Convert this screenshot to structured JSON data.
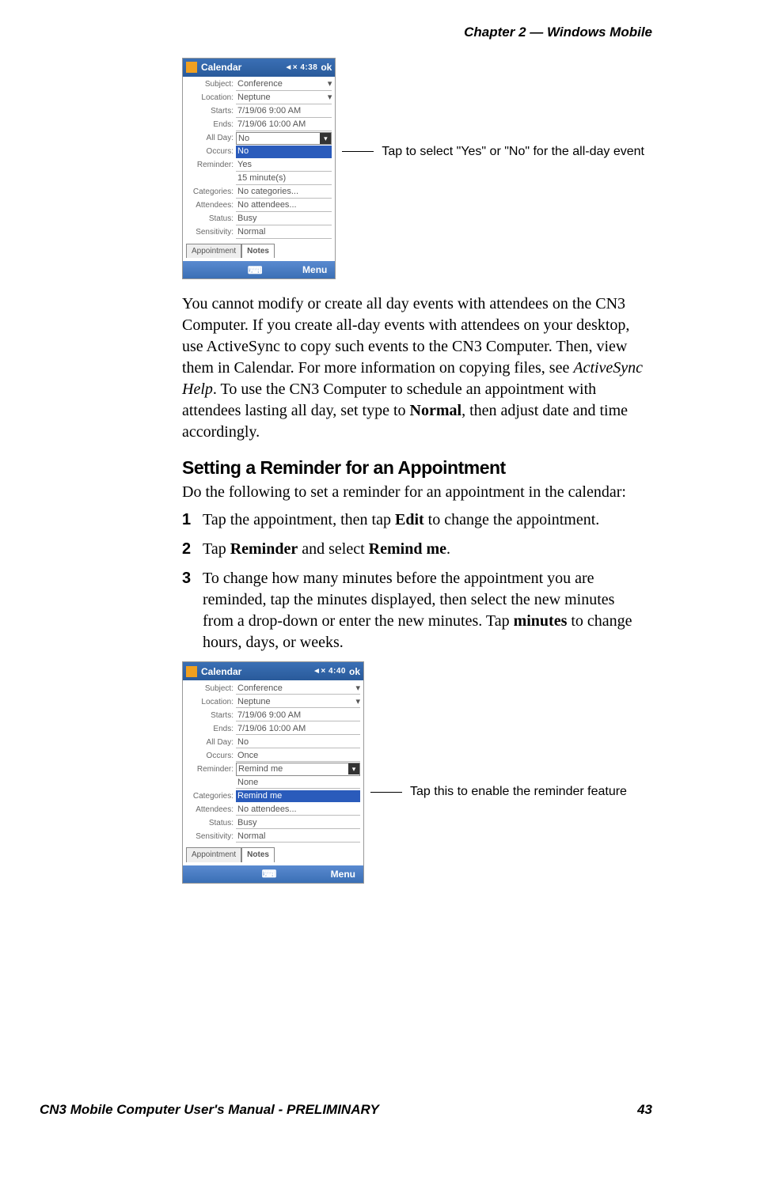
{
  "header": {
    "chapter": "Chapter 2 —  Windows Mobile"
  },
  "fig1": {
    "titlebar": {
      "title": "Calendar",
      "status": "◄× 4:38",
      "ok": "ok"
    },
    "rows": {
      "subject": {
        "label": "Subject:",
        "value": "Conference"
      },
      "location": {
        "label": "Location:",
        "value": "Neptune"
      },
      "starts": {
        "label": "Starts:",
        "value": "7/19/06    9:00 AM"
      },
      "ends": {
        "label": "Ends:",
        "value": "7/19/06    10:00 AM"
      },
      "allday": {
        "label": "All Day:",
        "value": "No"
      },
      "occurs": {
        "label": "Occurs:",
        "value": "No",
        "opt2": "Yes"
      },
      "reminder": {
        "label": "Reminder:",
        "value": "15      minute(s)"
      },
      "categories": {
        "label": "Categories:",
        "value": "No categories..."
      },
      "attendees": {
        "label": "Attendees:",
        "value": "No attendees..."
      },
      "status": {
        "label": "Status:",
        "value": "Busy"
      },
      "sensitivity": {
        "label": "Sensitivity:",
        "value": "Normal"
      }
    },
    "tabs": {
      "left": "Appointment",
      "right": "Notes"
    },
    "bottom": {
      "left": "",
      "mid": "⌨",
      "right": "Menu"
    },
    "callout": "Tap to select \"Yes\" or \"No\" for the all-day event"
  },
  "para1_a": "You cannot modify or create all day events with attendees on the CN3 Computer. If you create all-day events with attendees on your desktop, use ActiveSync to copy such events to the CN3 Computer. Then, view them in Calendar. For more information on copying files, see ",
  "para1_italic": "ActiveSync Help",
  "para1_b": ". To use the CN3 Computer to schedule an appointment with attendees lasting all day, set type to ",
  "para1_bold": "Normal",
  "para1_c": ", then adjust date and time accordingly.",
  "heading2": "Setting a Reminder for an Appointment",
  "para2": "Do the following to set a reminder for an appointment in the calendar:",
  "steps": {
    "s1": {
      "num": "1",
      "a": "Tap the appointment, then tap ",
      "b1": "Edit",
      "c": " to change the appointment."
    },
    "s2": {
      "num": "2",
      "a": "Tap ",
      "b1": "Reminder",
      "m": " and select ",
      "b2": "Remind me",
      "c": "."
    },
    "s3": {
      "num": "3",
      "a": "To change how many minutes before the appointment you are reminded, tap the minutes displayed, then select the new minutes from a drop-down or enter the new minutes. Tap ",
      "b1": "minutes",
      "c": " to change hours, days, or weeks."
    }
  },
  "fig2": {
    "titlebar": {
      "title": "Calendar",
      "status": "◄× 4:40",
      "ok": "ok"
    },
    "rows": {
      "subject": {
        "label": "Subject:",
        "value": "Conference"
      },
      "location": {
        "label": "Location:",
        "value": "Neptune"
      },
      "starts": {
        "label": "Starts:",
        "value": "7/19/06    9:00 AM"
      },
      "ends": {
        "label": "Ends:",
        "value": "7/19/06    10:00 AM"
      },
      "allday": {
        "label": "All Day:",
        "value": "No"
      },
      "occurs": {
        "label": "Occurs:",
        "value": "Once"
      },
      "reminder": {
        "label": "Reminder:",
        "value": "Remind me",
        "opt1": "None",
        "opt2": "Remind me"
      },
      "categories": {
        "label": "Categories:",
        "value": ""
      },
      "attendees": {
        "label": "Attendees:",
        "value": "No attendees..."
      },
      "status": {
        "label": "Status:",
        "value": "Busy"
      },
      "sensitivity": {
        "label": "Sensitivity:",
        "value": "Normal"
      }
    },
    "tabs": {
      "left": "Appointment",
      "right": "Notes"
    },
    "bottom": {
      "left": "",
      "mid": "⌨",
      "right": "Menu"
    },
    "callout": "Tap this to enable the reminder feature"
  },
  "footer": {
    "left": "CN3 Mobile Computer User's Manual - PRELIMINARY",
    "right": "43"
  }
}
